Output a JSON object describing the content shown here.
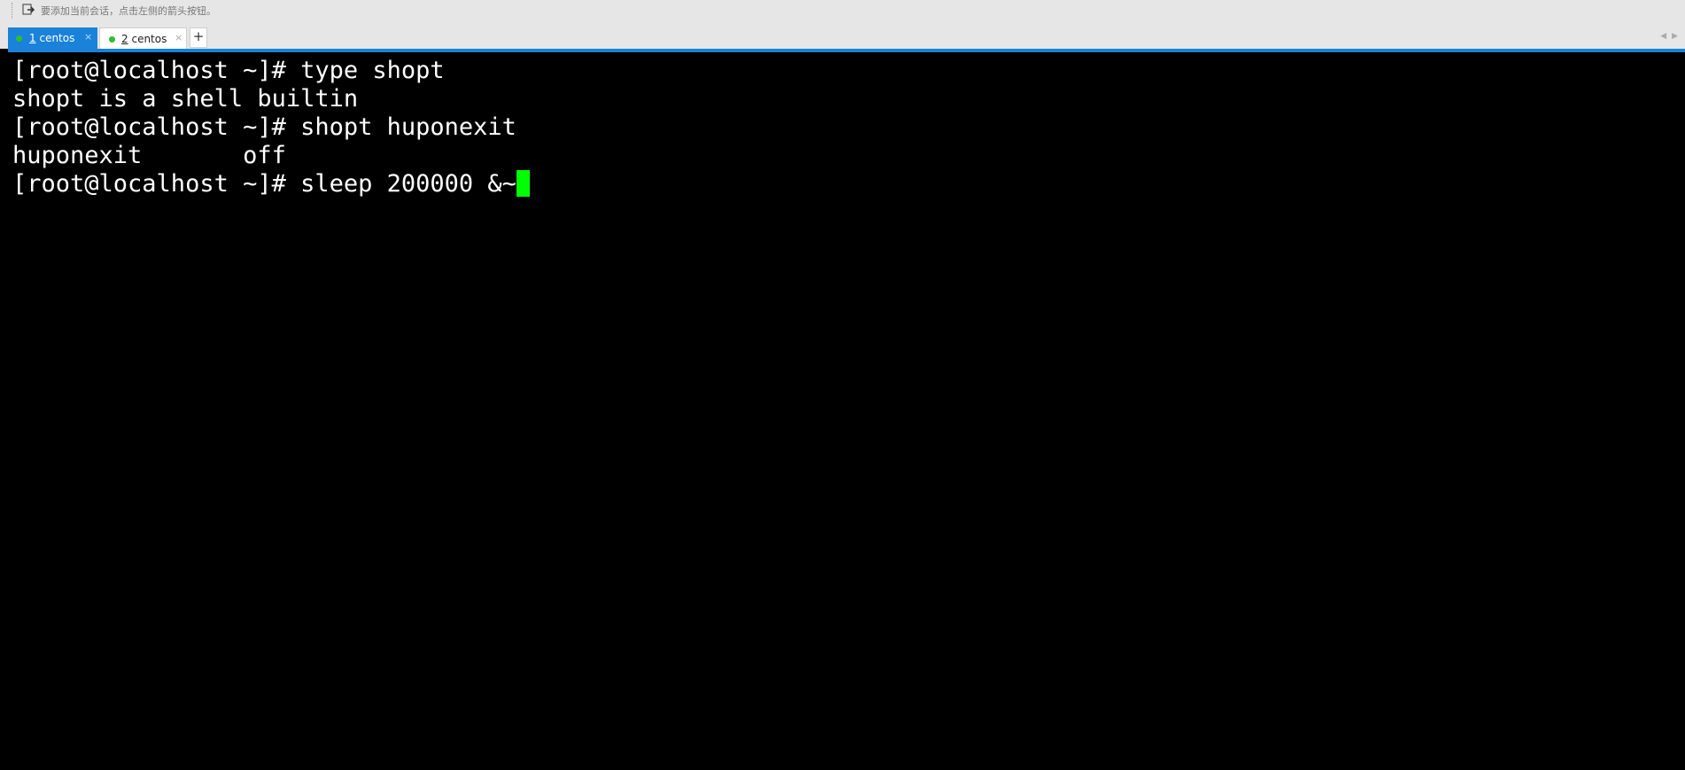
{
  "hint_bar": {
    "text": "要添加当前会话，点击左侧的箭头按钮。",
    "icon": "add-session-arrow-icon"
  },
  "tabs": [
    {
      "number": "1",
      "name": "centos",
      "active": true,
      "status_color": "#2bc02b",
      "close": "×"
    },
    {
      "number": "2",
      "name": "centos",
      "active": false,
      "status_color": "#2bc02b",
      "close": "×"
    }
  ],
  "add_tab_label": "+",
  "scroll_arrows": "◀▶",
  "terminal": {
    "lines": [
      "[root@localhost ~]# type shopt",
      "shopt is a shell builtin",
      "[root@localhost ~]# shopt huponexit",
      "huponexit      \toff",
      "[root@localhost ~]# sleep 200000 &~"
    ],
    "cursor_color": "#00ff00",
    "background": "#000000",
    "foreground": "#ffffff"
  }
}
